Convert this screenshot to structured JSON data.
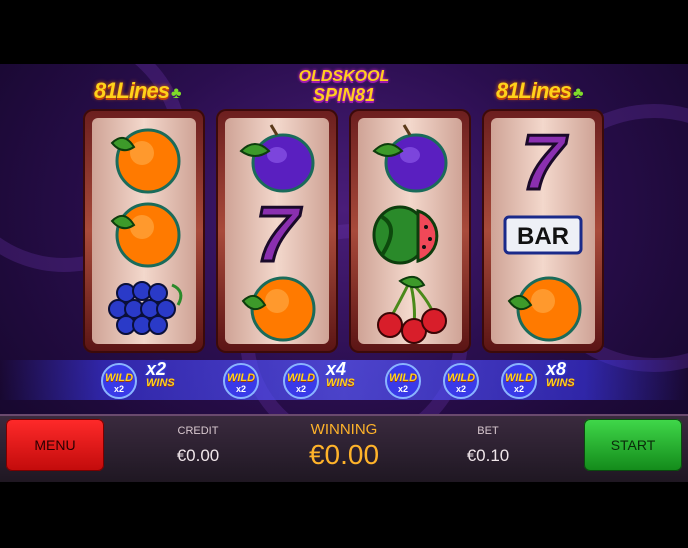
{
  "header": {
    "left_lines_logo": "81Lines",
    "right_lines_logo": "81Lines",
    "game_logo_line1": "OLDSKOOL",
    "game_logo_line2": "SPIN81"
  },
  "reels": [
    {
      "symbols": [
        "orange-icon",
        "orange-icon",
        "grapes-icon"
      ]
    },
    {
      "symbols": [
        "plum-icon",
        "seven-icon",
        "orange-icon"
      ]
    },
    {
      "symbols": [
        "plum-icon",
        "watermelon-icon",
        "cherries-icon"
      ]
    },
    {
      "symbols": [
        "seven-icon",
        "bar-icon",
        "orange-icon"
      ]
    }
  ],
  "symbol_text": {
    "bar": "BAR",
    "seven": "7"
  },
  "multipliers": [
    {
      "wild_count": 1,
      "label": "WILD",
      "wild_sub": "x2",
      "value": "x2",
      "wins_label": "WINS"
    },
    {
      "wild_count": 2,
      "label": "WILD",
      "wild_sub": "x2",
      "value": "x4",
      "wins_label": "WINS"
    },
    {
      "wild_count": 3,
      "label": "WILD",
      "wild_sub": "x2",
      "value": "x8",
      "wins_label": "WINS"
    }
  ],
  "footer": {
    "menu_label": "MENU",
    "credit_label": "CREDIT",
    "credit_value": "€0.00",
    "winning_label": "WINNING",
    "winning_value": "€0.00",
    "bet_label": "BET",
    "bet_value": "€0.10",
    "start_label": "START"
  },
  "colors": {
    "menu_button": "#e01818",
    "start_button": "#2bb534",
    "winning_text": "#ffb32a",
    "logo_yellow": "#ffd21a"
  }
}
